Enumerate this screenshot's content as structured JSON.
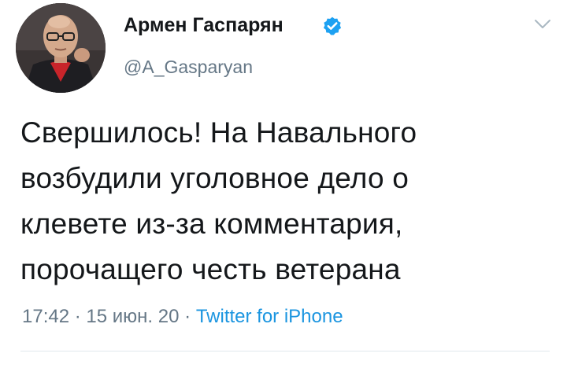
{
  "author": {
    "display_name": "Армен Гаспарян",
    "handle": "@A_Gasparyan",
    "verified": true
  },
  "tweet": {
    "lines": [
      "Свершилось! На Навального",
      "возбудили уголовное дело о",
      "клевете из-за комментария,",
      "порочащего честь ветерана"
    ],
    "time": "17:42",
    "date": "15 июн. 20",
    "separator": "·",
    "source": "Twitter for iPhone"
  },
  "icons": {
    "verified": "verified-badge-icon",
    "menu": "chevron-down-icon"
  },
  "colors": {
    "text": "#14171a",
    "secondary": "#657786",
    "link": "#1b95e0",
    "verified": "#1da1f2"
  }
}
